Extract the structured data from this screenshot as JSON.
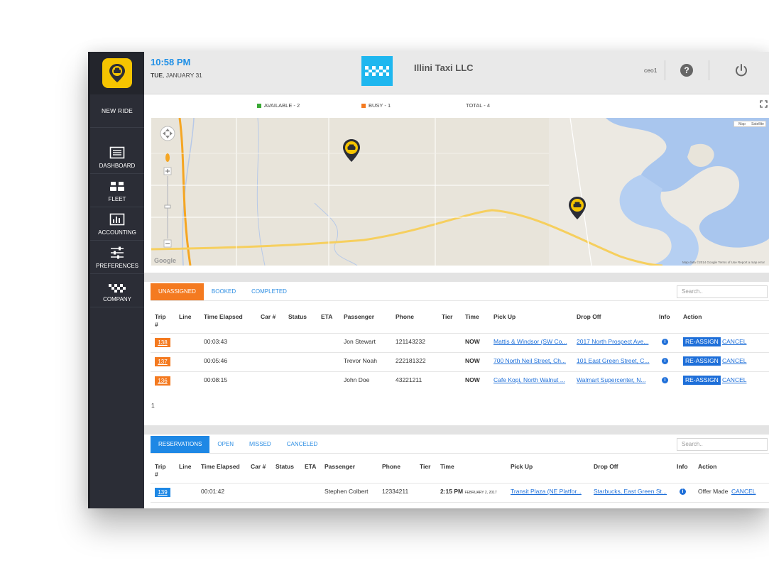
{
  "header": {
    "time": "10:58 PM",
    "day": "TUE",
    "date": ", JANUARY 31",
    "company": "Illini Taxi LLC",
    "user": "ceo1"
  },
  "sidebar": {
    "new_ride": "NEW RIDE",
    "items": [
      {
        "label": "DASHBOARD",
        "icon": "dashboard-icon"
      },
      {
        "label": "FLEET",
        "icon": "fleet-icon"
      },
      {
        "label": "ACCOUNTING",
        "icon": "accounting-icon"
      },
      {
        "label": "PREFERENCES",
        "icon": "preferences-icon"
      },
      {
        "label": "COMPANY",
        "icon": "company-icon"
      }
    ]
  },
  "status": {
    "available": "AVAILABLE - 2",
    "busy": "BUSY - 1",
    "total": "TOTAL - 4",
    "available_color": "#3aa935",
    "busy_color": "#f47a20"
  },
  "map": {
    "type_map": "Map",
    "type_satellite": "Satellite",
    "credit": "Map data ©2014 Google   Terms of Use   Report a map error",
    "logo": "Google"
  },
  "unassigned": {
    "tabs": [
      "UNASSIGNED",
      "BOOKED",
      "COMPLETED"
    ],
    "search_placeholder": "Search..",
    "headers": [
      "Trip #",
      "Line",
      "Time Elapsed",
      "Car #",
      "Status",
      "ETA",
      "Passenger",
      "Phone",
      "Tier",
      "Time",
      "Pick Up",
      "Drop Off",
      "Info",
      "Action"
    ],
    "rows": [
      {
        "trip": "138",
        "elapsed": "00:03:43",
        "passenger": "Jon Stewart",
        "phone": "121143232",
        "time": "NOW",
        "pickup": "Mattis & Windsor (SW Co...",
        "dropoff": "2017 North Prospect Ave..."
      },
      {
        "trip": "137",
        "elapsed": "00:05:46",
        "passenger": "Trevor Noah",
        "phone": "222181322",
        "time": "NOW",
        "pickup": "700 North Neil Street, Ch...",
        "dropoff": "101 East Green Street, C..."
      },
      {
        "trip": "136",
        "elapsed": "00:08:15",
        "passenger": "John Doe",
        "phone": "43221211",
        "time": "NOW",
        "pickup": "Cafe Kopi, North Walnut ...",
        "dropoff": "Walmart Supercenter, N..."
      }
    ],
    "action_reassign": "RE-ASSIGN",
    "action_cancel": "CANCEL",
    "page": "1"
  },
  "reservations": {
    "tabs": [
      "RESERVATIONS",
      "OPEN",
      "MISSED",
      "CANCELED"
    ],
    "search_placeholder": "Search..",
    "headers": [
      "Trip #",
      "Line",
      "Time Elapsed",
      "Car #",
      "Status",
      "ETA",
      "Passenger",
      "Phone",
      "Tier",
      "Time",
      "Pick Up",
      "Drop Off",
      "Info",
      "Action"
    ],
    "rows": [
      {
        "trip": "139",
        "elapsed": "00:01:42",
        "passenger": "Stephen Colbert",
        "phone": "12334211",
        "time": "2:15 PM",
        "time_date": "FEBRUARY 2, 2017",
        "pickup": "Transit Plaza (NE Platfor...",
        "dropoff": "Starbucks, East Green St...",
        "action_text": "Offer Made",
        "action_cancel": "CANCEL"
      }
    ]
  }
}
